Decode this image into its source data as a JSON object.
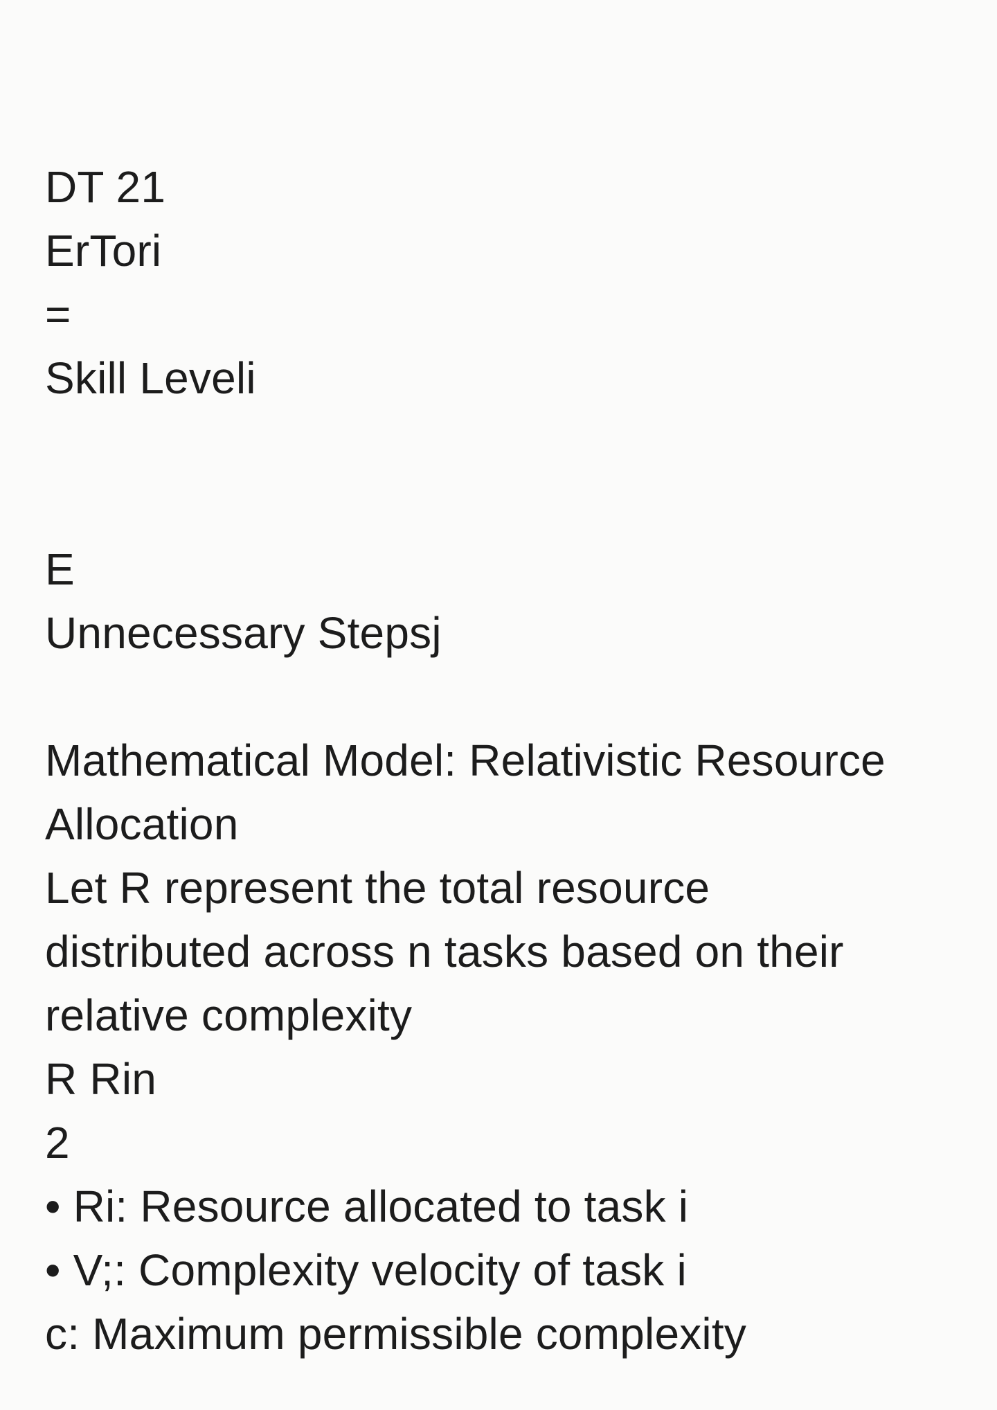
{
  "lines": [
    "DT 21",
    "ErTori",
    "=",
    "Skill Leveli",
    "E",
    "Unnecessary Stepsj",
    "Mathematical Model: Relativistic Resource",
    "Allocation",
    "Let R represent the total resource",
    "distributed across n tasks based on their",
    "relative complexity",
    "R Rin",
    "2",
    "• Ri: Resource allocated to task i",
    "• V;: Complexity velocity of task i",
    "c: Maximum permissible complexity"
  ]
}
